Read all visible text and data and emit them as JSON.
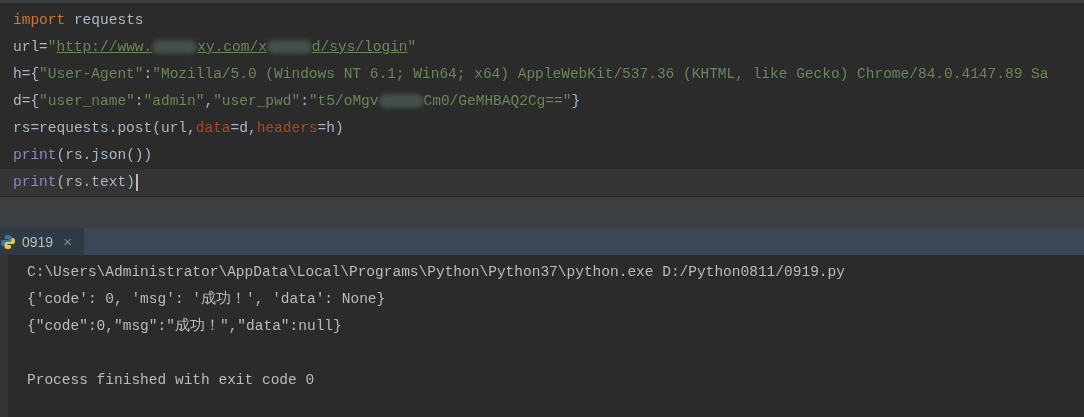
{
  "editor": {
    "lines": [
      {
        "current": false,
        "tokens": [
          {
            "kind": "keyword",
            "text": "import"
          },
          {
            "kind": "plain",
            "text": " requests"
          }
        ]
      },
      {
        "current": false,
        "tokens": [
          {
            "kind": "plain",
            "text": "url="
          },
          {
            "kind": "string",
            "text": "\""
          },
          {
            "kind": "link",
            "text": "http://www."
          },
          {
            "kind": "redacted"
          },
          {
            "kind": "link",
            "text": "xy.com/x"
          },
          {
            "kind": "redacted"
          },
          {
            "kind": "link",
            "text": "d/sys/login"
          },
          {
            "kind": "string",
            "text": "\""
          }
        ]
      },
      {
        "current": false,
        "tokens": [
          {
            "kind": "plain",
            "text": "h={"
          },
          {
            "kind": "string",
            "text": "\"User-Agent\""
          },
          {
            "kind": "plain",
            "text": ":"
          },
          {
            "kind": "string",
            "text": "\"Mozilla/5.0 (Windows NT 6.1; Win64; x64) AppleWebKit/537.36 (KHTML, like Gecko) Chrome/84.0.4147.89 Sa"
          }
        ]
      },
      {
        "current": false,
        "tokens": [
          {
            "kind": "plain",
            "text": "d={"
          },
          {
            "kind": "string",
            "text": "\"user_name\""
          },
          {
            "kind": "plain",
            "text": ":"
          },
          {
            "kind": "string",
            "text": "\"admin\""
          },
          {
            "kind": "plain",
            "text": ","
          },
          {
            "kind": "string",
            "text": "\"user_pwd\""
          },
          {
            "kind": "plain",
            "text": ":"
          },
          {
            "kind": "string",
            "text": "\"t5/oMgv"
          },
          {
            "kind": "redacted"
          },
          {
            "kind": "string",
            "text": "Cm0/GeMHBAQ2Cg==\""
          },
          {
            "kind": "plain",
            "text": "}"
          }
        ]
      },
      {
        "current": false,
        "tokens": [
          {
            "kind": "plain",
            "text": "rs=requests.post(url,"
          },
          {
            "kind": "param",
            "text": "data"
          },
          {
            "kind": "plain",
            "text": "=d,"
          },
          {
            "kind": "param",
            "text": "headers"
          },
          {
            "kind": "plain",
            "text": "=h)"
          }
        ]
      },
      {
        "current": false,
        "tokens": [
          {
            "kind": "builtin",
            "text": "print"
          },
          {
            "kind": "plain",
            "text": "(rs.json())"
          }
        ]
      },
      {
        "current": true,
        "tokens": [
          {
            "kind": "builtin",
            "text": "print"
          },
          {
            "kind": "plain",
            "text": "(rs.text)"
          }
        ]
      }
    ]
  },
  "run_tab": {
    "label": "0919",
    "close": "×",
    "selected": true
  },
  "console": {
    "lines": [
      {
        "kind": "output",
        "text": "C:\\Users\\Administrator\\AppData\\Local\\Programs\\Python\\Python37\\python.exe D:/Python0811/0919.py"
      },
      {
        "kind": "output",
        "text": "{'code': 0, 'msg': '成功！', 'data': None}"
      },
      {
        "kind": "output",
        "text": "{\"code\":0,\"msg\":\"成功！\",\"data\":null}"
      },
      {
        "kind": "blank"
      },
      {
        "kind": "output",
        "text": "Process finished with exit code 0"
      }
    ]
  }
}
